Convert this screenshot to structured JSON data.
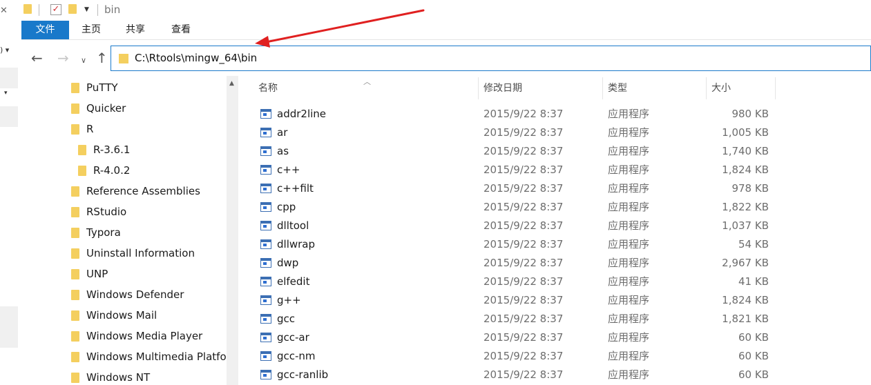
{
  "window": {
    "title": "bin"
  },
  "ribbon": {
    "tabs": [
      "文件",
      "主页",
      "共享",
      "查看"
    ]
  },
  "address": {
    "path": "C:\\Rtools\\mingw_64\\bin"
  },
  "nav_tree": [
    "PuTTY",
    "Quicker",
    "R",
    "R-3.6.1",
    "R-4.0.2",
    "Reference Assemblies",
    "RStudio",
    "Typora",
    "Uninstall Information",
    "UNP",
    "Windows Defender",
    "Windows Mail",
    "Windows Media Player",
    "Windows Multimedia Platfor",
    "Windows NT"
  ],
  "columns": {
    "name": "名称",
    "date": "修改日期",
    "type": "类型",
    "size": "大小"
  },
  "files": [
    {
      "name": "addr2line",
      "date": "2015/9/22 8:37",
      "type": "应用程序",
      "size": "980 KB"
    },
    {
      "name": "ar",
      "date": "2015/9/22 8:37",
      "type": "应用程序",
      "size": "1,005 KB"
    },
    {
      "name": "as",
      "date": "2015/9/22 8:37",
      "type": "应用程序",
      "size": "1,740 KB"
    },
    {
      "name": "c++",
      "date": "2015/9/22 8:37",
      "type": "应用程序",
      "size": "1,824 KB"
    },
    {
      "name": "c++filt",
      "date": "2015/9/22 8:37",
      "type": "应用程序",
      "size": "978 KB"
    },
    {
      "name": "cpp",
      "date": "2015/9/22 8:37",
      "type": "应用程序",
      "size": "1,822 KB"
    },
    {
      "name": "dlltool",
      "date": "2015/9/22 8:37",
      "type": "应用程序",
      "size": "1,037 KB"
    },
    {
      "name": "dllwrap",
      "date": "2015/9/22 8:37",
      "type": "应用程序",
      "size": "54 KB"
    },
    {
      "name": "dwp",
      "date": "2015/9/22 8:37",
      "type": "应用程序",
      "size": "2,967 KB"
    },
    {
      "name": "elfedit",
      "date": "2015/9/22 8:37",
      "type": "应用程序",
      "size": "41 KB"
    },
    {
      "name": "g++",
      "date": "2015/9/22 8:37",
      "type": "应用程序",
      "size": "1,824 KB"
    },
    {
      "name": "gcc",
      "date": "2015/9/22 8:37",
      "type": "应用程序",
      "size": "1,821 KB"
    },
    {
      "name": "gcc-ar",
      "date": "2015/9/22 8:37",
      "type": "应用程序",
      "size": "60 KB"
    },
    {
      "name": "gcc-nm",
      "date": "2015/9/22 8:37",
      "type": "应用程序",
      "size": "60 KB"
    },
    {
      "name": "gcc-ranlib",
      "date": "2015/9/22 8:37",
      "type": "应用程序",
      "size": "60 KB"
    }
  ],
  "colors": {
    "accent": "#1979ca",
    "folder": "#f4cf5f",
    "arrow": "#e02020"
  }
}
